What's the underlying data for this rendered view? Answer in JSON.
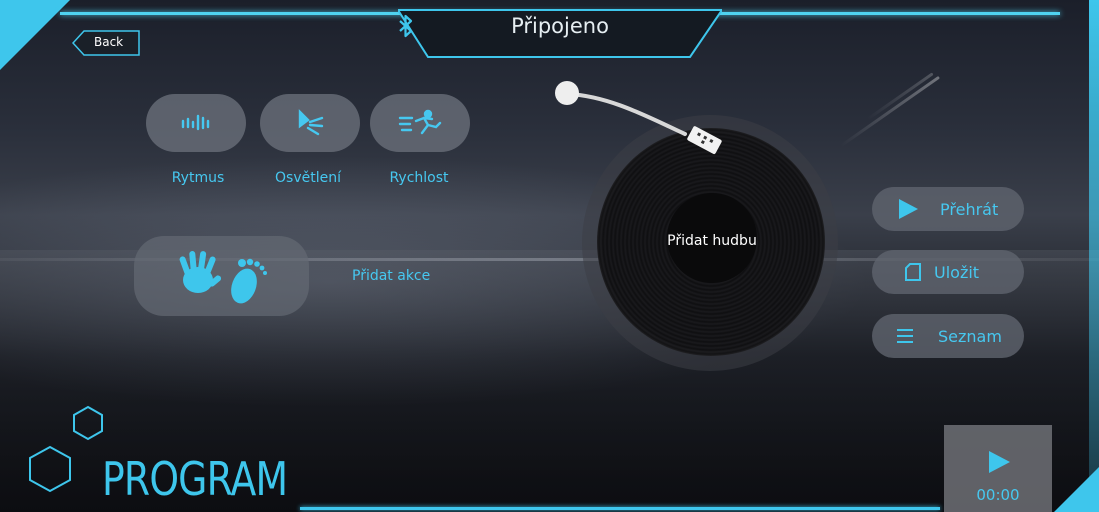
{
  "header": {
    "status": "Připojeno"
  },
  "back": {
    "label": "Back"
  },
  "features": [
    {
      "label": "Rytmus",
      "icon": "rhythm-icon"
    },
    {
      "label": "Osvětlení",
      "icon": "light-icon"
    },
    {
      "label": "Rychlost",
      "icon": "speed-icon"
    }
  ],
  "actions": {
    "label": "Přidat akce"
  },
  "record": {
    "label": "Přidat hudbu"
  },
  "side_buttons": [
    {
      "label": "Přehrát",
      "icon": "play-icon"
    },
    {
      "label": "Uložit",
      "icon": "save-icon"
    },
    {
      "label": "Seznam",
      "icon": "list-icon"
    }
  ],
  "program": {
    "title": "PROGRAM"
  },
  "timer": {
    "time": "00:00"
  },
  "colors": {
    "accent": "#3ec6ec",
    "button_bg": "#6e737d"
  }
}
